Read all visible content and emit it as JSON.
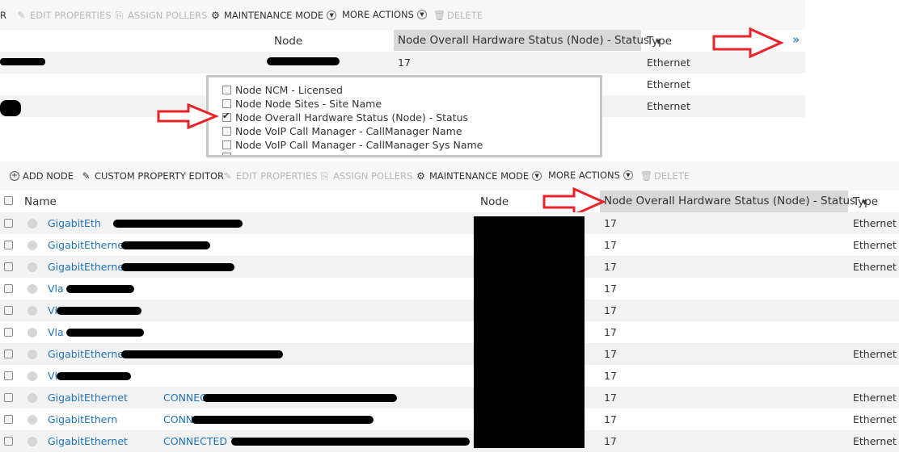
{
  "top": {
    "toolbar": {
      "edge_fragment": "R",
      "edit_properties": "EDIT PROPERTIES",
      "assign_pollers": "ASSIGN POLLERS",
      "maintenance_mode": "MAINTENANCE MODE",
      "more_actions": "MORE ACTIONS",
      "delete": "DELETE"
    },
    "columns": {
      "node": "Node",
      "hw_status": "Node Overall Hardware Status (Node) - Status",
      "type": "Type",
      "expand": "»"
    },
    "rows": [
      {
        "status": "17",
        "type": "Ethernet"
      },
      {
        "status": "",
        "type": "Ethernet"
      },
      {
        "status": "",
        "type": "Ethernet"
      }
    ]
  },
  "column_picker": {
    "items": [
      {
        "label": "Node NCM - Licensed",
        "checked": false
      },
      {
        "label": "Node Node Sites - Site Name",
        "checked": false
      },
      {
        "label": "Node Overall Hardware Status (Node) - Status",
        "checked": true
      },
      {
        "label": "Node VoIP Call Manager - CallManager Name",
        "checked": false
      },
      {
        "label": "Node VoIP Call Manager - CallManager Sys Name",
        "checked": false
      }
    ]
  },
  "bottom": {
    "toolbar": {
      "add_node": "ADD NODE",
      "custom_property_editor": "CUSTOM PROPERTY EDITOR",
      "edit_properties": "EDIT PROPERTIES",
      "assign_pollers": "ASSIGN POLLERS",
      "maintenance_mode": "MAINTENANCE MODE",
      "more_actions": "MORE ACTIONS",
      "delete": "DELETE"
    },
    "columns": {
      "name": "Name",
      "node": "Node",
      "hw_status": "Node Overall Hardware Status (Node) - Status",
      "type": "Type"
    },
    "rows": [
      {
        "name": "GigabitEth",
        "suffix": "",
        "status": "17",
        "type": "Ethernet"
      },
      {
        "name": "GigabitEthernet",
        "suffix": "",
        "status": "17",
        "type": "Ethernet"
      },
      {
        "name": "GigabitEthernet",
        "suffix": "",
        "status": "17",
        "type": "Ethernet"
      },
      {
        "name": "Vla",
        "suffix": "",
        "status": "17",
        "type": ""
      },
      {
        "name": "Vl",
        "suffix": "",
        "status": "17",
        "type": ""
      },
      {
        "name": "Vla",
        "suffix": "",
        "status": "17",
        "type": ""
      },
      {
        "name": "GigabitEthernet",
        "suffix": "",
        "status": "17",
        "type": "Ethernet"
      },
      {
        "name": "Vl",
        "suffix": "",
        "status": "17",
        "type": ""
      },
      {
        "name": "GigabitEthernet",
        "suffix": "CONNECT",
        "status": "17",
        "type": "Ethernet"
      },
      {
        "name": "GigabitEthern",
        "suffix": "CONNE",
        "status": "17",
        "type": "Ethernet"
      },
      {
        "name": "GigabitEthernet",
        "suffix": "CONNECTED TO",
        "status": "17",
        "type": "Ethernet"
      }
    ]
  }
}
